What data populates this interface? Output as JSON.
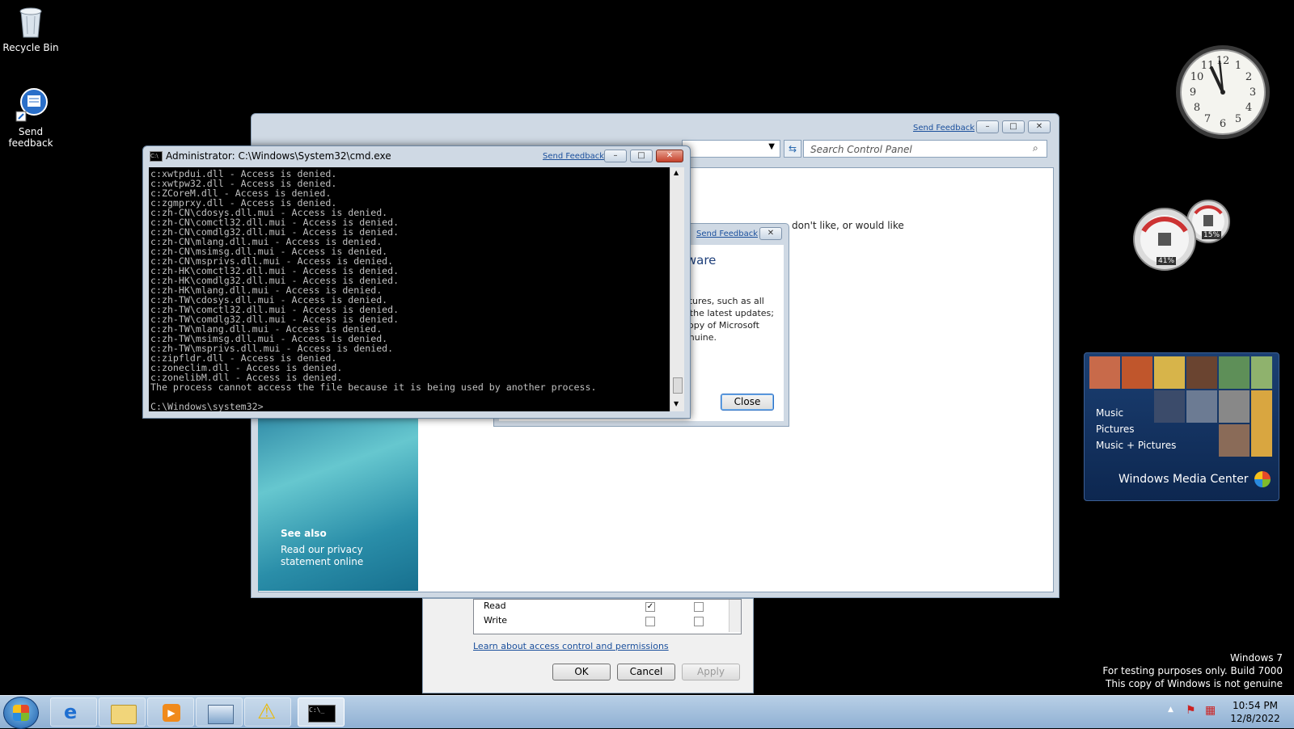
{
  "desktop": {
    "icons": [
      {
        "label": "Recycle Bin"
      },
      {
        "label": "Send feedback"
      }
    ],
    "watermark": {
      "line1": "Windows 7",
      "line2": "For testing purposes only. Build 7000",
      "line3": "This copy of Windows is not genuine"
    }
  },
  "gadgets": {
    "clock": {
      "numerals": [
        "12",
        "1",
        "2",
        "3",
        "4",
        "5",
        "6",
        "7",
        "8",
        "9",
        "10",
        "11"
      ]
    },
    "meter": {
      "cpu": "41%",
      "memory": "15%"
    },
    "media_center": {
      "items": [
        "Music",
        "Pictures",
        "Music + Pictures"
      ],
      "title": "Windows Media Center"
    }
  },
  "control_panel": {
    "send_feedback": "Send Feedback",
    "search_placeholder": "Search Control Panel",
    "body_text_fragment": "e, don't like, or would like",
    "see_also": {
      "title": "See also",
      "link": "Read our privacy statement online"
    }
  },
  "genuine_dialog": {
    "send_feedback": "Send Feedback",
    "heading_fragment": "tware",
    "text_lines": [
      "atures, such as all",
      "t the latest updates;",
      "copy of Microsoft",
      "enuine."
    ],
    "close_label": "Close"
  },
  "permissions_dialog": {
    "rows": [
      {
        "label": "Read",
        "allow": true,
        "deny": false
      },
      {
        "label": "Write",
        "allow": false,
        "deny": false
      }
    ],
    "learn_link": "Learn about access control and permissions",
    "ok_label": "OK",
    "cancel_label": "Cancel",
    "apply_label": "Apply"
  },
  "cmd_window": {
    "title": "Administrator: C:\\Windows\\System32\\cmd.exe",
    "send_feedback": "Send Feedback",
    "lines": [
      "c:xwtpdui.dll - Access is denied.",
      "c:xwtpw32.dll - Access is denied.",
      "c:ZCoreM.dll - Access is denied.",
      "c:zgmprxy.dll - Access is denied.",
      "c:zh-CN\\cdosys.dll.mui - Access is denied.",
      "c:zh-CN\\comctl32.dll.mui - Access is denied.",
      "c:zh-CN\\comdlg32.dll.mui - Access is denied.",
      "c:zh-CN\\mlang.dll.mui - Access is denied.",
      "c:zh-CN\\msimsg.dll.mui - Access is denied.",
      "c:zh-CN\\msprivs.dll.mui - Access is denied.",
      "c:zh-HK\\comctl32.dll.mui - Access is denied.",
      "c:zh-HK\\comdlg32.dll.mui - Access is denied.",
      "c:zh-HK\\mlang.dll.mui - Access is denied.",
      "c:zh-TW\\cdosys.dll.mui - Access is denied.",
      "c:zh-TW\\comctl32.dll.mui - Access is denied.",
      "c:zh-TW\\comdlg32.dll.mui - Access is denied.",
      "c:zh-TW\\mlang.dll.mui - Access is denied.",
      "c:zh-TW\\msimsg.dll.mui - Access is denied.",
      "c:zh-TW\\msprivs.dll.mui - Access is denied.",
      "c:zipfldr.dll - Access is denied.",
      "c:zoneclim.dll - Access is denied.",
      "c:zonelibM.dll - Access is denied.",
      "The process cannot access the file because it is being used by another process.",
      "",
      "C:\\Windows\\system32>_"
    ]
  },
  "taskbar": {
    "clock_time": "10:54 PM",
    "clock_date": "12/8/2022",
    "cmd_icon_text": "C:\\_"
  },
  "colors": {
    "desktop": "#000000",
    "cmd_bg": "#000000",
    "cmd_fg": "#c0c0c0",
    "taskbar": "#a6c1de"
  }
}
